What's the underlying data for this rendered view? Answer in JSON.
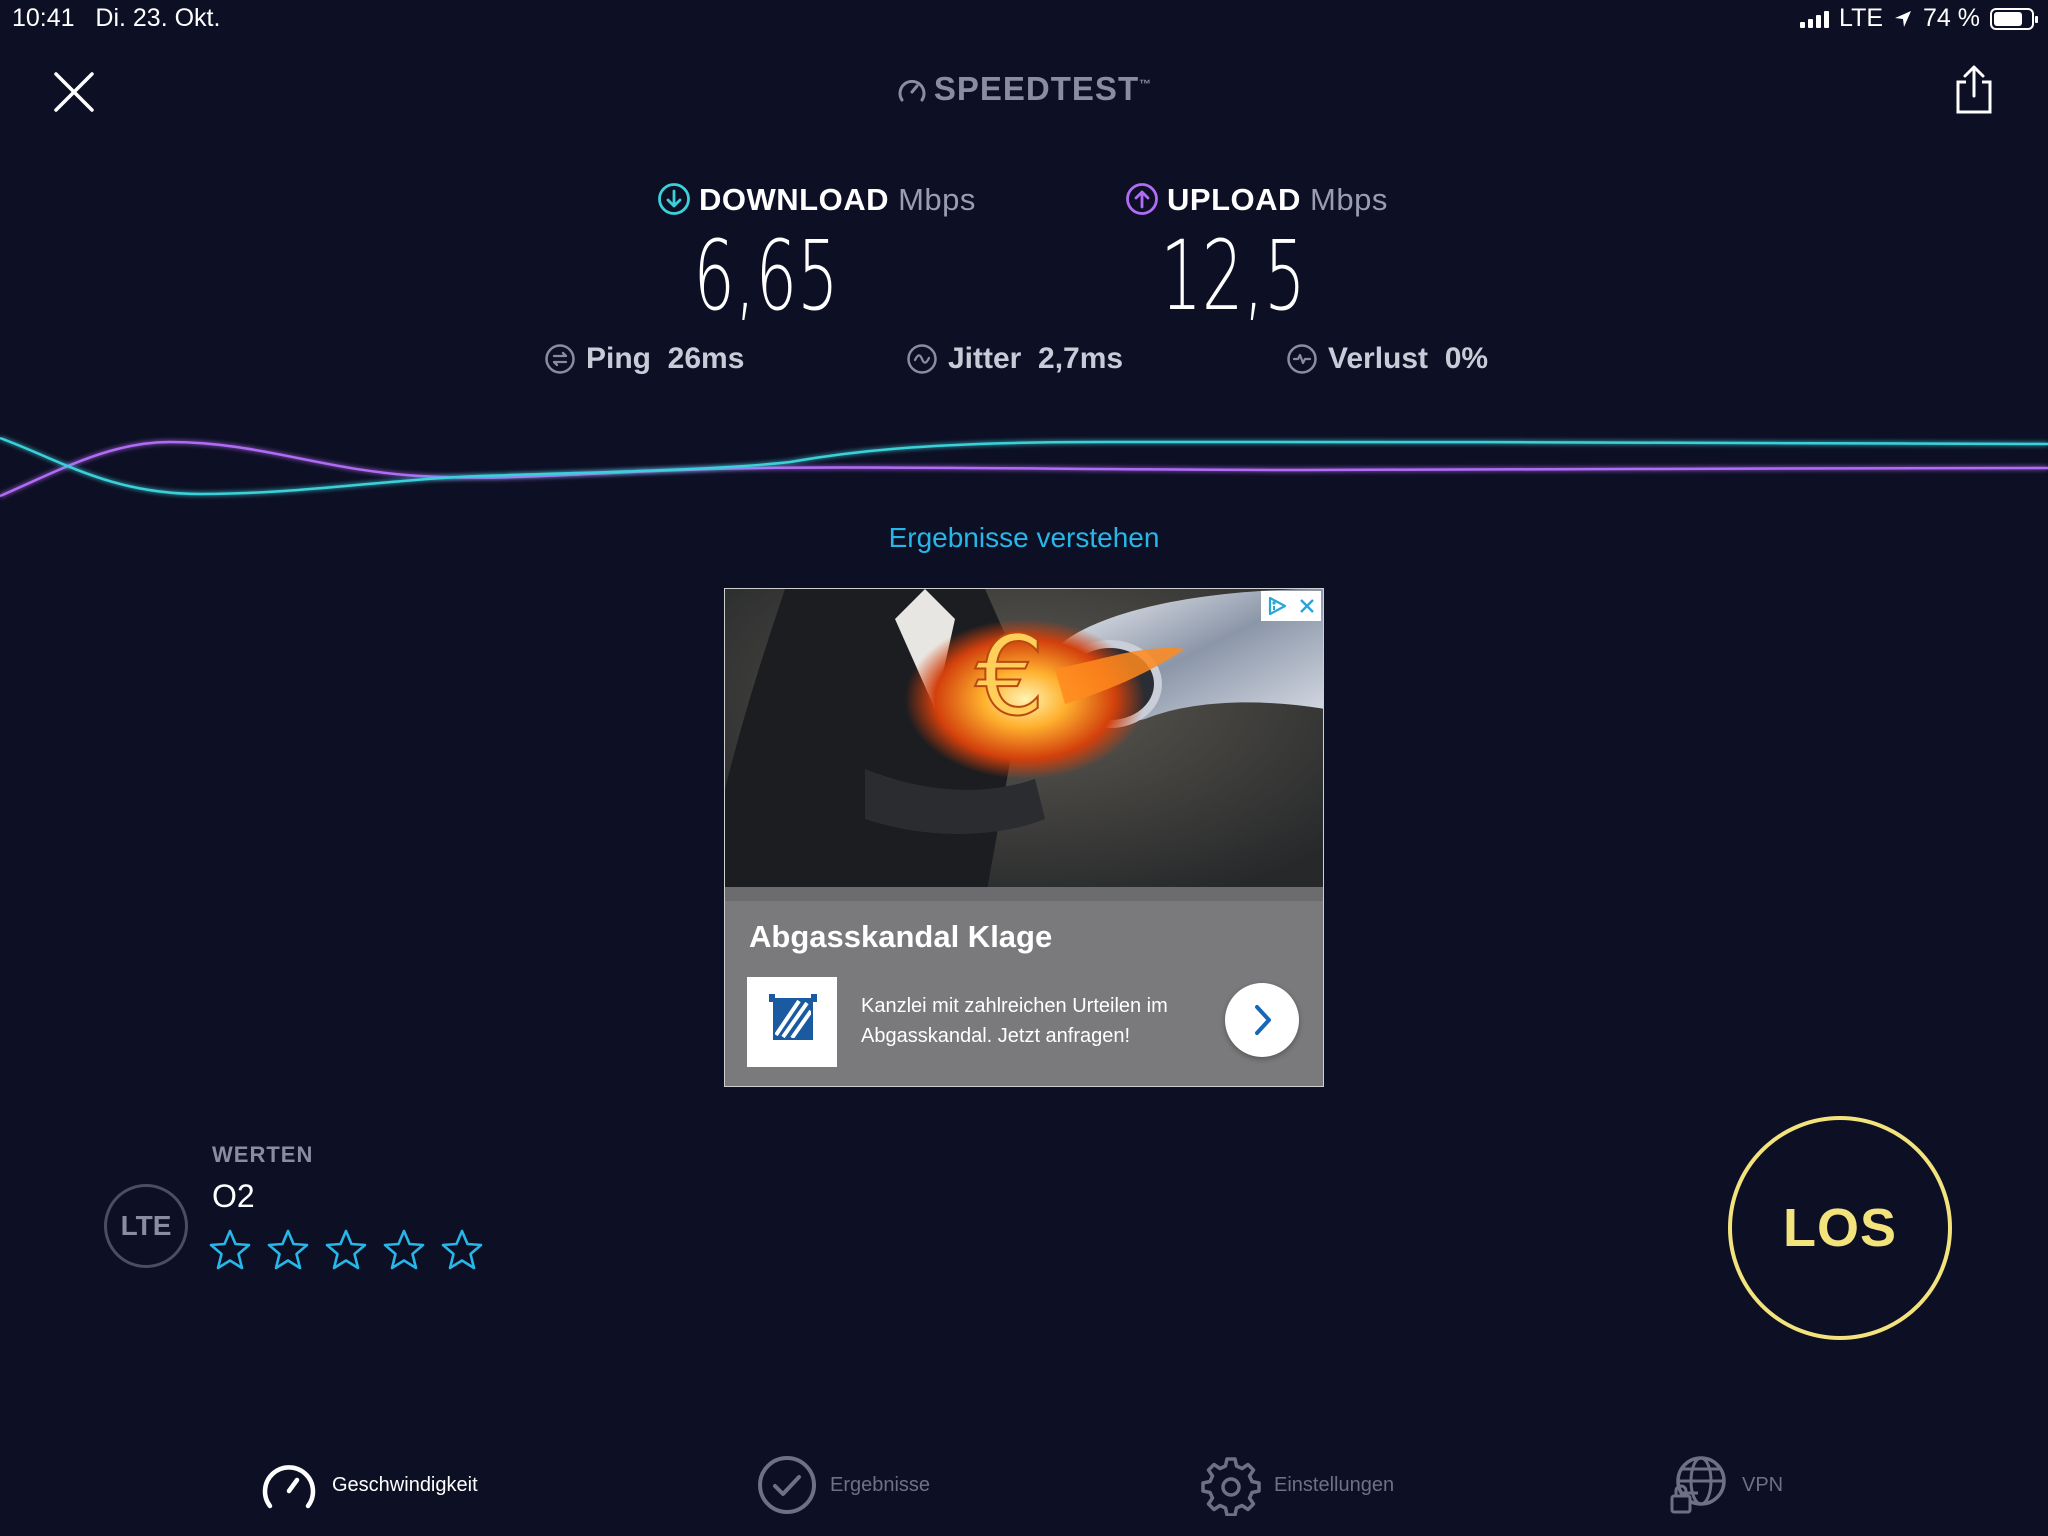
{
  "status_bar": {
    "time": "10:41",
    "date": "Di. 23. Okt.",
    "network": "LTE",
    "battery": "74 %"
  },
  "header": {
    "brand": "SPEEDTEST",
    "brand_mark": "™"
  },
  "download": {
    "label": "DOWNLOAD",
    "unit": "Mbps",
    "value": "6,65",
    "color": "#3ad1d9"
  },
  "upload": {
    "label": "UPLOAD",
    "unit": "Mbps",
    "value": "12,5",
    "color": "#b16cf5"
  },
  "stats": {
    "ping_label": "Ping",
    "ping_value": "26ms",
    "jitter_label": "Jitter",
    "jitter_value": "2,7ms",
    "loss_label": "Verlust",
    "loss_value": "0%"
  },
  "results_link": "Ergebnisse verstehen",
  "ad": {
    "headline": "Abgasskandal Klage",
    "body": "Kanzlei mit zahlreichen Urteilen im Abgasskandal. Jetzt anfragen!"
  },
  "provider": {
    "badge": "LTE",
    "rate_label": "WERTEN",
    "name": "O2",
    "star_count": 5,
    "star_color": "#27b6e8"
  },
  "go_button": {
    "label": "LOS",
    "color": "#f3e37c"
  },
  "tabs": [
    {
      "label": "Geschwindigkeit",
      "icon": "speedometer-icon",
      "active": true
    },
    {
      "label": "Ergebnisse",
      "icon": "check-circle-icon",
      "active": false
    },
    {
      "label": "Einstellungen",
      "icon": "gear-icon",
      "active": false
    },
    {
      "label": "VPN",
      "icon": "globe-lock-icon",
      "active": false
    }
  ]
}
